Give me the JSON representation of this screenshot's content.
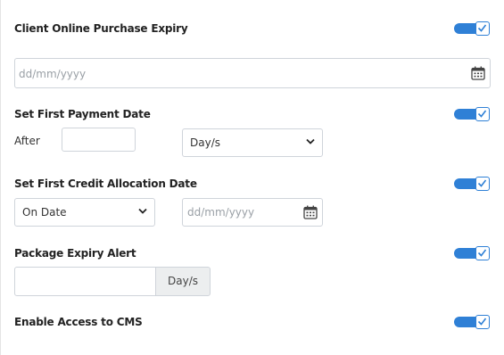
{
  "sections": {
    "client_online_purchase_expiry": {
      "label": "Client Online Purchase Expiry",
      "enabled": true,
      "date_placeholder": "dd/mm/yyyy"
    },
    "first_payment_date": {
      "label": "Set First Payment Date",
      "enabled": true,
      "after_label": "After",
      "after_value": "",
      "unit_selected": "Day/s"
    },
    "first_credit_allocation_date": {
      "label": "Set First Credit Allocation Date",
      "enabled": true,
      "mode_selected": "On Date",
      "date_placeholder": "dd/mm/yyyy"
    },
    "package_expiry_alert": {
      "label": "Package Expiry Alert",
      "enabled": true,
      "value": "",
      "unit": "Day/s"
    },
    "enable_access_to_cms": {
      "label": "Enable Access to CMS",
      "enabled": true
    }
  },
  "colors": {
    "accent": "#2f80d6",
    "border": "#cfd4da",
    "addon_bg": "#eceeef"
  },
  "icons": {
    "calendar": "calendar-icon",
    "chevron": "chevron-down-icon",
    "check": "check-icon"
  }
}
